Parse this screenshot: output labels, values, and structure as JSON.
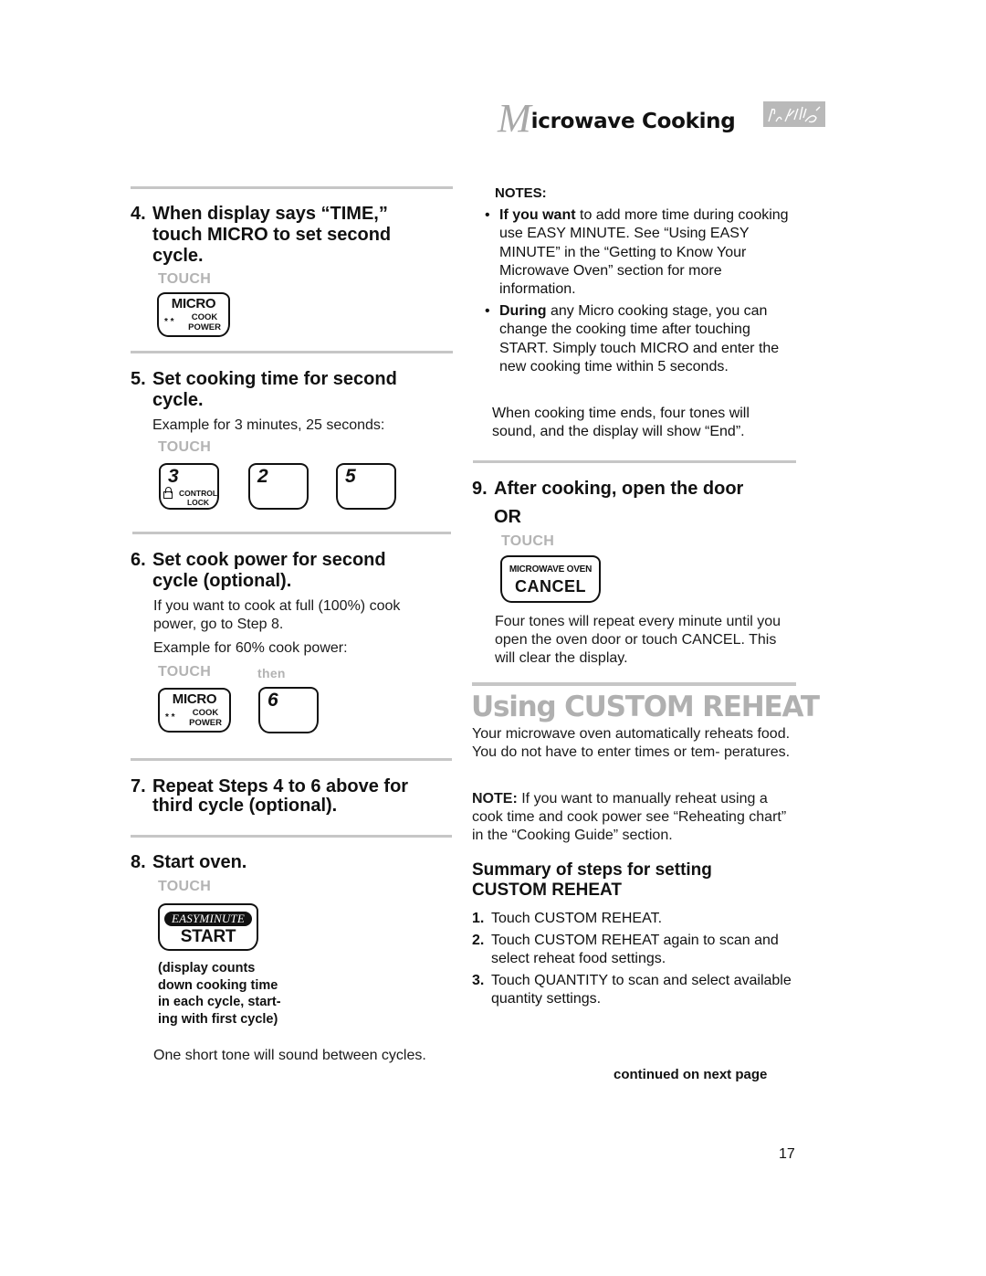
{
  "header": {
    "title_initial": "M",
    "title_rest": "icrowave Cooking",
    "logo_icon": "signature-logo"
  },
  "left": {
    "step4": {
      "num": "4.",
      "heading": "When display says “TIME,” touch MICRO to set second cycle.",
      "touch": "TOUCH",
      "key": {
        "line1": "MICRO",
        "line2": "COOK",
        "line3": "POWER",
        "stars": "* *"
      }
    },
    "step5": {
      "num": "5.",
      "heading": "Set cooking time for second cycle.",
      "example": "Example for 3 minutes, 25 seconds:",
      "touch": "TOUCH",
      "keys": [
        {
          "digit": "3",
          "sub1": "CONTROL",
          "sub2": "LOCK",
          "icon": "lock-icon"
        },
        {
          "digit": "2"
        },
        {
          "digit": "5"
        }
      ]
    },
    "step6": {
      "num": "6.",
      "heading": "Set cook power for second cycle (optional).",
      "text1": "If you want to cook at full (100%) cook power, go to Step 8.",
      "example": "Example for 60% cook power:",
      "touch": "TOUCH",
      "then": "then",
      "key": {
        "line1": "MICRO",
        "line2": "COOK",
        "line3": "POWER",
        "stars": "* *"
      },
      "digit": "6"
    },
    "step7": {
      "num": "7.",
      "heading": "Repeat Steps 4 to 6 above for third cycle (optional)."
    },
    "step8": {
      "num": "8.",
      "heading": "Start oven.",
      "touch": "TOUCH",
      "key": {
        "top": "EASYMINUTE",
        "bottom": "START"
      },
      "caption": "(display counts down cooking time in each cycle, start- ing with first cycle)",
      "caption_lines": [
        "(display counts",
        "down cooking time",
        "in each cycle, start-",
        "ing with first cycle)"
      ],
      "footer": "One short tone will sound between cycles."
    }
  },
  "right": {
    "notes": {
      "title": "NOTES:",
      "items": [
        {
          "bold": "If you want",
          "text": " to add more time during cooking use EASY MINUTE. See “Using EASY MINUTE” in the “Getting to Know Your Microwave Oven” section for more information."
        },
        {
          "bold": "During",
          "text": " any Micro cooking stage, you can change the cooking time after touching START. Simply touch MICRO and enter the new cooking time within 5 seconds."
        }
      ],
      "end_text": "When cooking time ends, four tones will sound, and the display will show “End”."
    },
    "step9": {
      "num": "9.",
      "heading": "After cooking, open the door",
      "or": "OR",
      "touch": "TOUCH",
      "key": {
        "line1": "MICROWAVE OVEN",
        "line2": "CANCEL"
      },
      "text": "Four tones will repeat every minute until you open the oven door or touch CANCEL. This will clear the display."
    },
    "custom_reheat": {
      "title": "Using CUSTOM REHEAT",
      "intro": "Your microwave oven automatically reheats food. You do not have to enter times or tem- peratures.",
      "note_label": "NOTE:",
      "note_text": " If you want to manually reheat using a cook time and cook power see “Reheating chart” in the “Cooking Guide” section.",
      "summary_heading_1": "Summary of steps for setting",
      "summary_heading_2": "CUSTOM REHEAT",
      "steps": [
        {
          "n": "1.",
          "t": "Touch CUSTOM REHEAT."
        },
        {
          "n": "2.",
          "t": "Touch CUSTOM REHEAT again to scan and select reheat food settings."
        },
        {
          "n": "3.",
          "t": "Touch QUANTITY to scan and select available quantity settings."
        }
      ],
      "continued": "continued on next page"
    }
  },
  "page_number": "17"
}
